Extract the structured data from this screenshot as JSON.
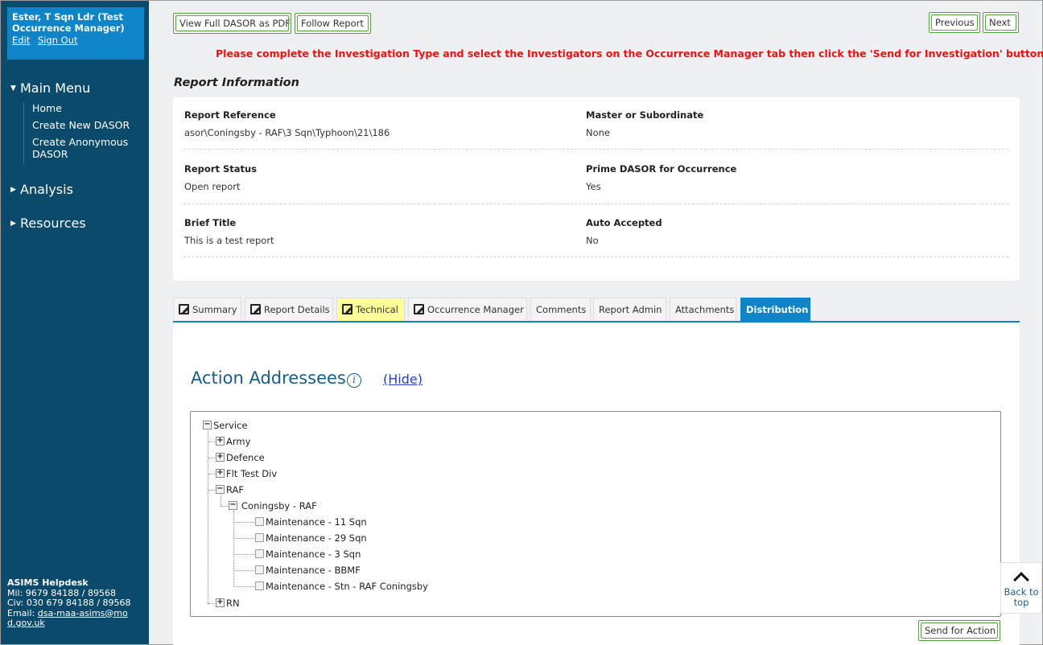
{
  "user": {
    "name": "Ester, T Sqn Ldr (Test Occurrence Manager)",
    "edit": "Edit",
    "sign_out": "Sign Out"
  },
  "menu": {
    "main": "Main Menu",
    "items": [
      "Home",
      "Create New DASOR",
      "Create Anonymous DASOR"
    ],
    "analysis": "Analysis",
    "resources": "Resources"
  },
  "helpdesk": {
    "title": "ASIMS Helpdesk",
    "mil": "Mil: 9679 84188 / 89568",
    "civ": "Civ: 030 679 84188 / 89568",
    "email_label": "Email:",
    "email": "dsa-maa-asims@mod.gov.uk"
  },
  "toolbar": {
    "view_pdf": "View Full DASOR as PDF",
    "follow": "Follow Report",
    "previous": "Previous",
    "next": "Next"
  },
  "warning": "Please complete the Investigation Type and select the Investigators on the Occurrence Manager tab then click the 'Send for Investigation' button.",
  "report_info": {
    "title": "Report Information",
    "fields": [
      {
        "label": "Report Reference",
        "value": "asor\\Coningsby - RAF\\3 Sqn\\Typhoon\\21\\186"
      },
      {
        "label": "Master or Subordinate",
        "value": "None"
      },
      {
        "label": "Report Status",
        "value": "Open report"
      },
      {
        "label": "Prime DASOR for Occurrence",
        "value": "Yes"
      },
      {
        "label": "Brief Title",
        "value": "This is a test report"
      },
      {
        "label": "Auto Accepted",
        "value": "No"
      }
    ]
  },
  "tabs": [
    "Summary",
    "Report Details",
    "Technical",
    "Occurrence Manager",
    "Comments",
    "Report Admin",
    "Attachments",
    "Distribution"
  ],
  "action_addressees": {
    "title": "Action Addressees",
    "hide": "(Hide)",
    "tree": {
      "root": "Service",
      "army": "Army",
      "defence": "Defence",
      "flt": "Flt Test Div",
      "raf": "RAF",
      "coningsby": "Coningsby - RAF",
      "leaves": [
        "Maintenance - 11 Sqn",
        "Maintenance - 29 Sqn",
        "Maintenance - 3 Sqn",
        "Maintenance - BBMF",
        "Maintenance - Stn - RAF Coningsby"
      ],
      "rn": "RN"
    },
    "send": "Send for Action"
  },
  "back_to_top": "Back to top",
  "colors": {
    "sidebar": "#0b4a6b",
    "accent": "#0f84c9",
    "warning": "#ef1010",
    "button_border": "#53a43a",
    "highlight_tab": "#ffff99"
  }
}
